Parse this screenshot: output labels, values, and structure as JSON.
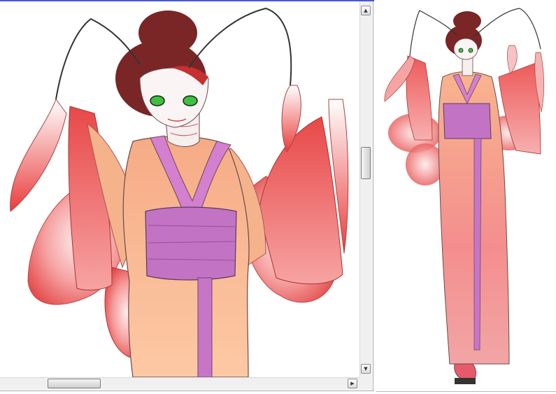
{
  "zoom_view": {
    "artwork_icon": "moth-geisha-closeup-artwork",
    "scroll_up_glyph": "▲",
    "scroll_down_glyph": "▼",
    "scroll_right_glyph": "▶"
  },
  "preview_view": {
    "artwork_icon": "moth-geisha-full-figure-artwork"
  },
  "colors": {
    "accent": "#4a57d6",
    "hair": "#7a2526",
    "kimono": "#f8b48e",
    "obi": "#c776c7",
    "sleeve": "#ef6b6b",
    "wing": "#e64848"
  }
}
